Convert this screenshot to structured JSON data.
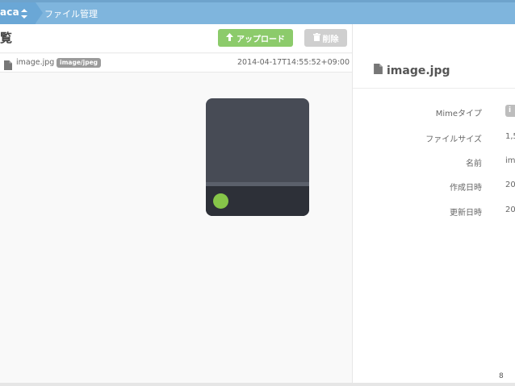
{
  "breadcrumb": {
    "app_label": "aca",
    "page_label": "ファイル管理"
  },
  "list": {
    "title": "覧",
    "upload_label": "アップロード",
    "delete_label": "削除",
    "files": [
      {
        "name": "image.jpg",
        "mime": "image/jpeg",
        "date": "2014-04-17T14:55:52+09:00"
      }
    ]
  },
  "preview": {
    "colors": {
      "body": "#474b55",
      "stripe": "#5b606b",
      "base": "#2d3038",
      "dot": "#86c549"
    }
  },
  "details": {
    "title": "image.jpg",
    "properties": [
      {
        "label": "Mimeタイプ",
        "value": "i"
      },
      {
        "label": "ファイルサイズ",
        "value": "1,5"
      },
      {
        "label": "名前",
        "value": "ima"
      },
      {
        "label": "作成日時",
        "value": "20"
      },
      {
        "label": "更新日時",
        "value": "20"
      }
    ]
  },
  "pagination": {
    "page": "8"
  },
  "colors": {
    "topbar": "#7fb5dd",
    "upload_button": "#8ccb6b",
    "delete_button_disabled": "#cfcfcf"
  },
  "icons": {
    "toggle": "chevron-updown-icon",
    "upload": "arrow-up-icon",
    "delete": "trash-icon",
    "file": "file-icon"
  }
}
